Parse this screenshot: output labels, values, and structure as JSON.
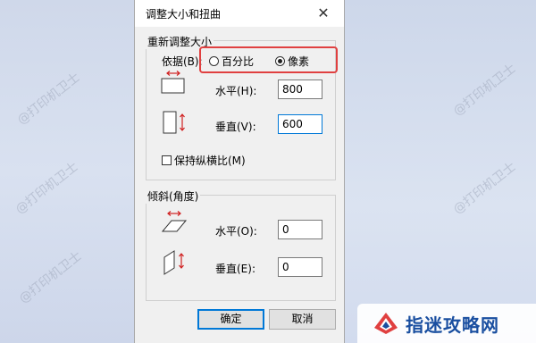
{
  "background": {
    "watermark": "@打印机卫士"
  },
  "dialog": {
    "title": "调整大小和扭曲",
    "close_glyph": "✕",
    "resize": {
      "group_label": "重新调整大小",
      "basis_label": "依据(B):",
      "options": [
        {
          "label": "百分比",
          "selected": false
        },
        {
          "label": "像素",
          "selected": true
        }
      ],
      "horizontal_label": "水平(H):",
      "horizontal_value": "800",
      "vertical_label": "垂直(V):",
      "vertical_value": "600",
      "keep_ratio_label": "保持纵横比(M)",
      "keep_ratio_checked": false
    },
    "skew": {
      "group_label": "倾斜(角度)",
      "horizontal_label": "水平(O):",
      "horizontal_value": "0",
      "vertical_label": "垂直(E):",
      "vertical_value": "0"
    },
    "ok_label": "确定",
    "cancel_label": "取消"
  },
  "brand": {
    "name": "指迷攻略网",
    "color": "#1a4fa0",
    "accent": "#e04040"
  }
}
